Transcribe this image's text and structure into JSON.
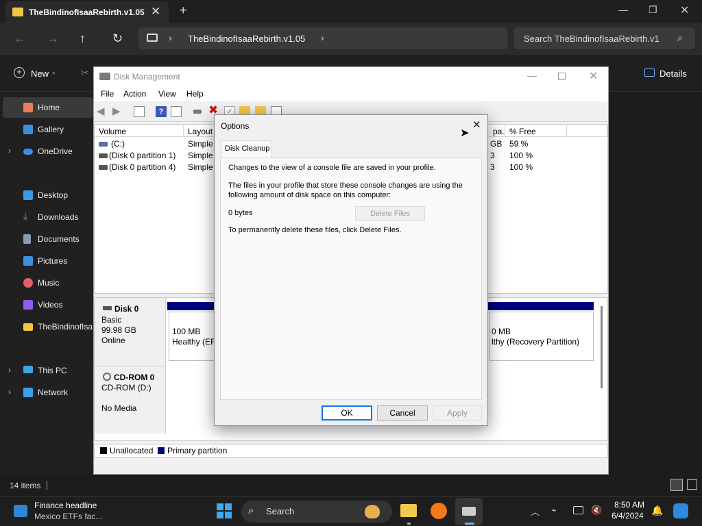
{
  "explorer": {
    "tab_title": "TheBindinofIsaaRebirth.v1.05",
    "breadcrumb": "TheBindinofIsaaRebirth.v1.05",
    "search_placeholder": "Search TheBindinofIsaaRebirth.v1",
    "new_label": "New",
    "details_label": "Details",
    "sidebar": [
      {
        "label": "Home",
        "icon": "home-icon"
      },
      {
        "label": "Gallery",
        "icon": "gallery-icon"
      },
      {
        "label": "OneDrive",
        "icon": "onedrive-icon"
      },
      {
        "label": "Desktop",
        "icon": "desktop-icon"
      },
      {
        "label": "Downloads",
        "icon": "downloads-icon"
      },
      {
        "label": "Documents",
        "icon": "documents-icon"
      },
      {
        "label": "Pictures",
        "icon": "pictures-icon"
      },
      {
        "label": "Music",
        "icon": "music-icon"
      },
      {
        "label": "Videos",
        "icon": "videos-icon"
      },
      {
        "label": "TheBindinofIsa",
        "icon": "folder-icon"
      },
      {
        "label": "This PC",
        "icon": "this-pc-icon"
      },
      {
        "label": "Network",
        "icon": "network-icon"
      }
    ],
    "status_items": "14 items"
  },
  "disk_mgmt": {
    "title": "Disk Management",
    "menu": [
      "File",
      "Action",
      "View",
      "Help"
    ],
    "columns": [
      "Volume",
      "Layout",
      "pa...",
      "% Free"
    ],
    "volumes": [
      {
        "name": "(C:)",
        "layout": "Simple",
        "cap": "GB",
        "free": "59 %"
      },
      {
        "name": "(Disk 0 partition 1)",
        "layout": "Simple",
        "cap": "3",
        "free": "100 %"
      },
      {
        "name": "(Disk 0 partition 4)",
        "layout": "Simple",
        "cap": "3",
        "free": "100 %"
      }
    ],
    "disk0": {
      "name": "Disk 0",
      "type": "Basic",
      "size": "99.98 GB",
      "state": "Online"
    },
    "part_efi": {
      "size": "100 MB",
      "status": "Healthy (EFI"
    },
    "part_rec": {
      "size": "0 MB",
      "status": "lthy (Recovery Partition)"
    },
    "cdrom": {
      "name": "CD-ROM 0",
      "drive": "CD-ROM (D:)",
      "media": "No Media"
    },
    "legend": {
      "unalloc": "Unallocated",
      "primary": "Primary partition"
    }
  },
  "options": {
    "title": "Options",
    "tab": "Disk Cleanup",
    "text1": "Changes to the view of a console file are saved in your profile.",
    "text2a": "The files in your profile that store these console changes are using the",
    "text2b": "following amount of disk space on this computer:",
    "bytes": "0 bytes",
    "delete_btn": "Delete Files",
    "text3": "To permanently delete these files, click Delete Files.",
    "ok": "OK",
    "cancel": "Cancel",
    "apply": "Apply"
  },
  "taskbar": {
    "news_title": "Finance headline",
    "news_sub": "Mexico ETFs fac...",
    "search": "Search",
    "time": "8:50 AM",
    "date": "6/4/2024"
  },
  "colors": {
    "accent": "#1a73e8",
    "primary_partition": "#000080"
  }
}
